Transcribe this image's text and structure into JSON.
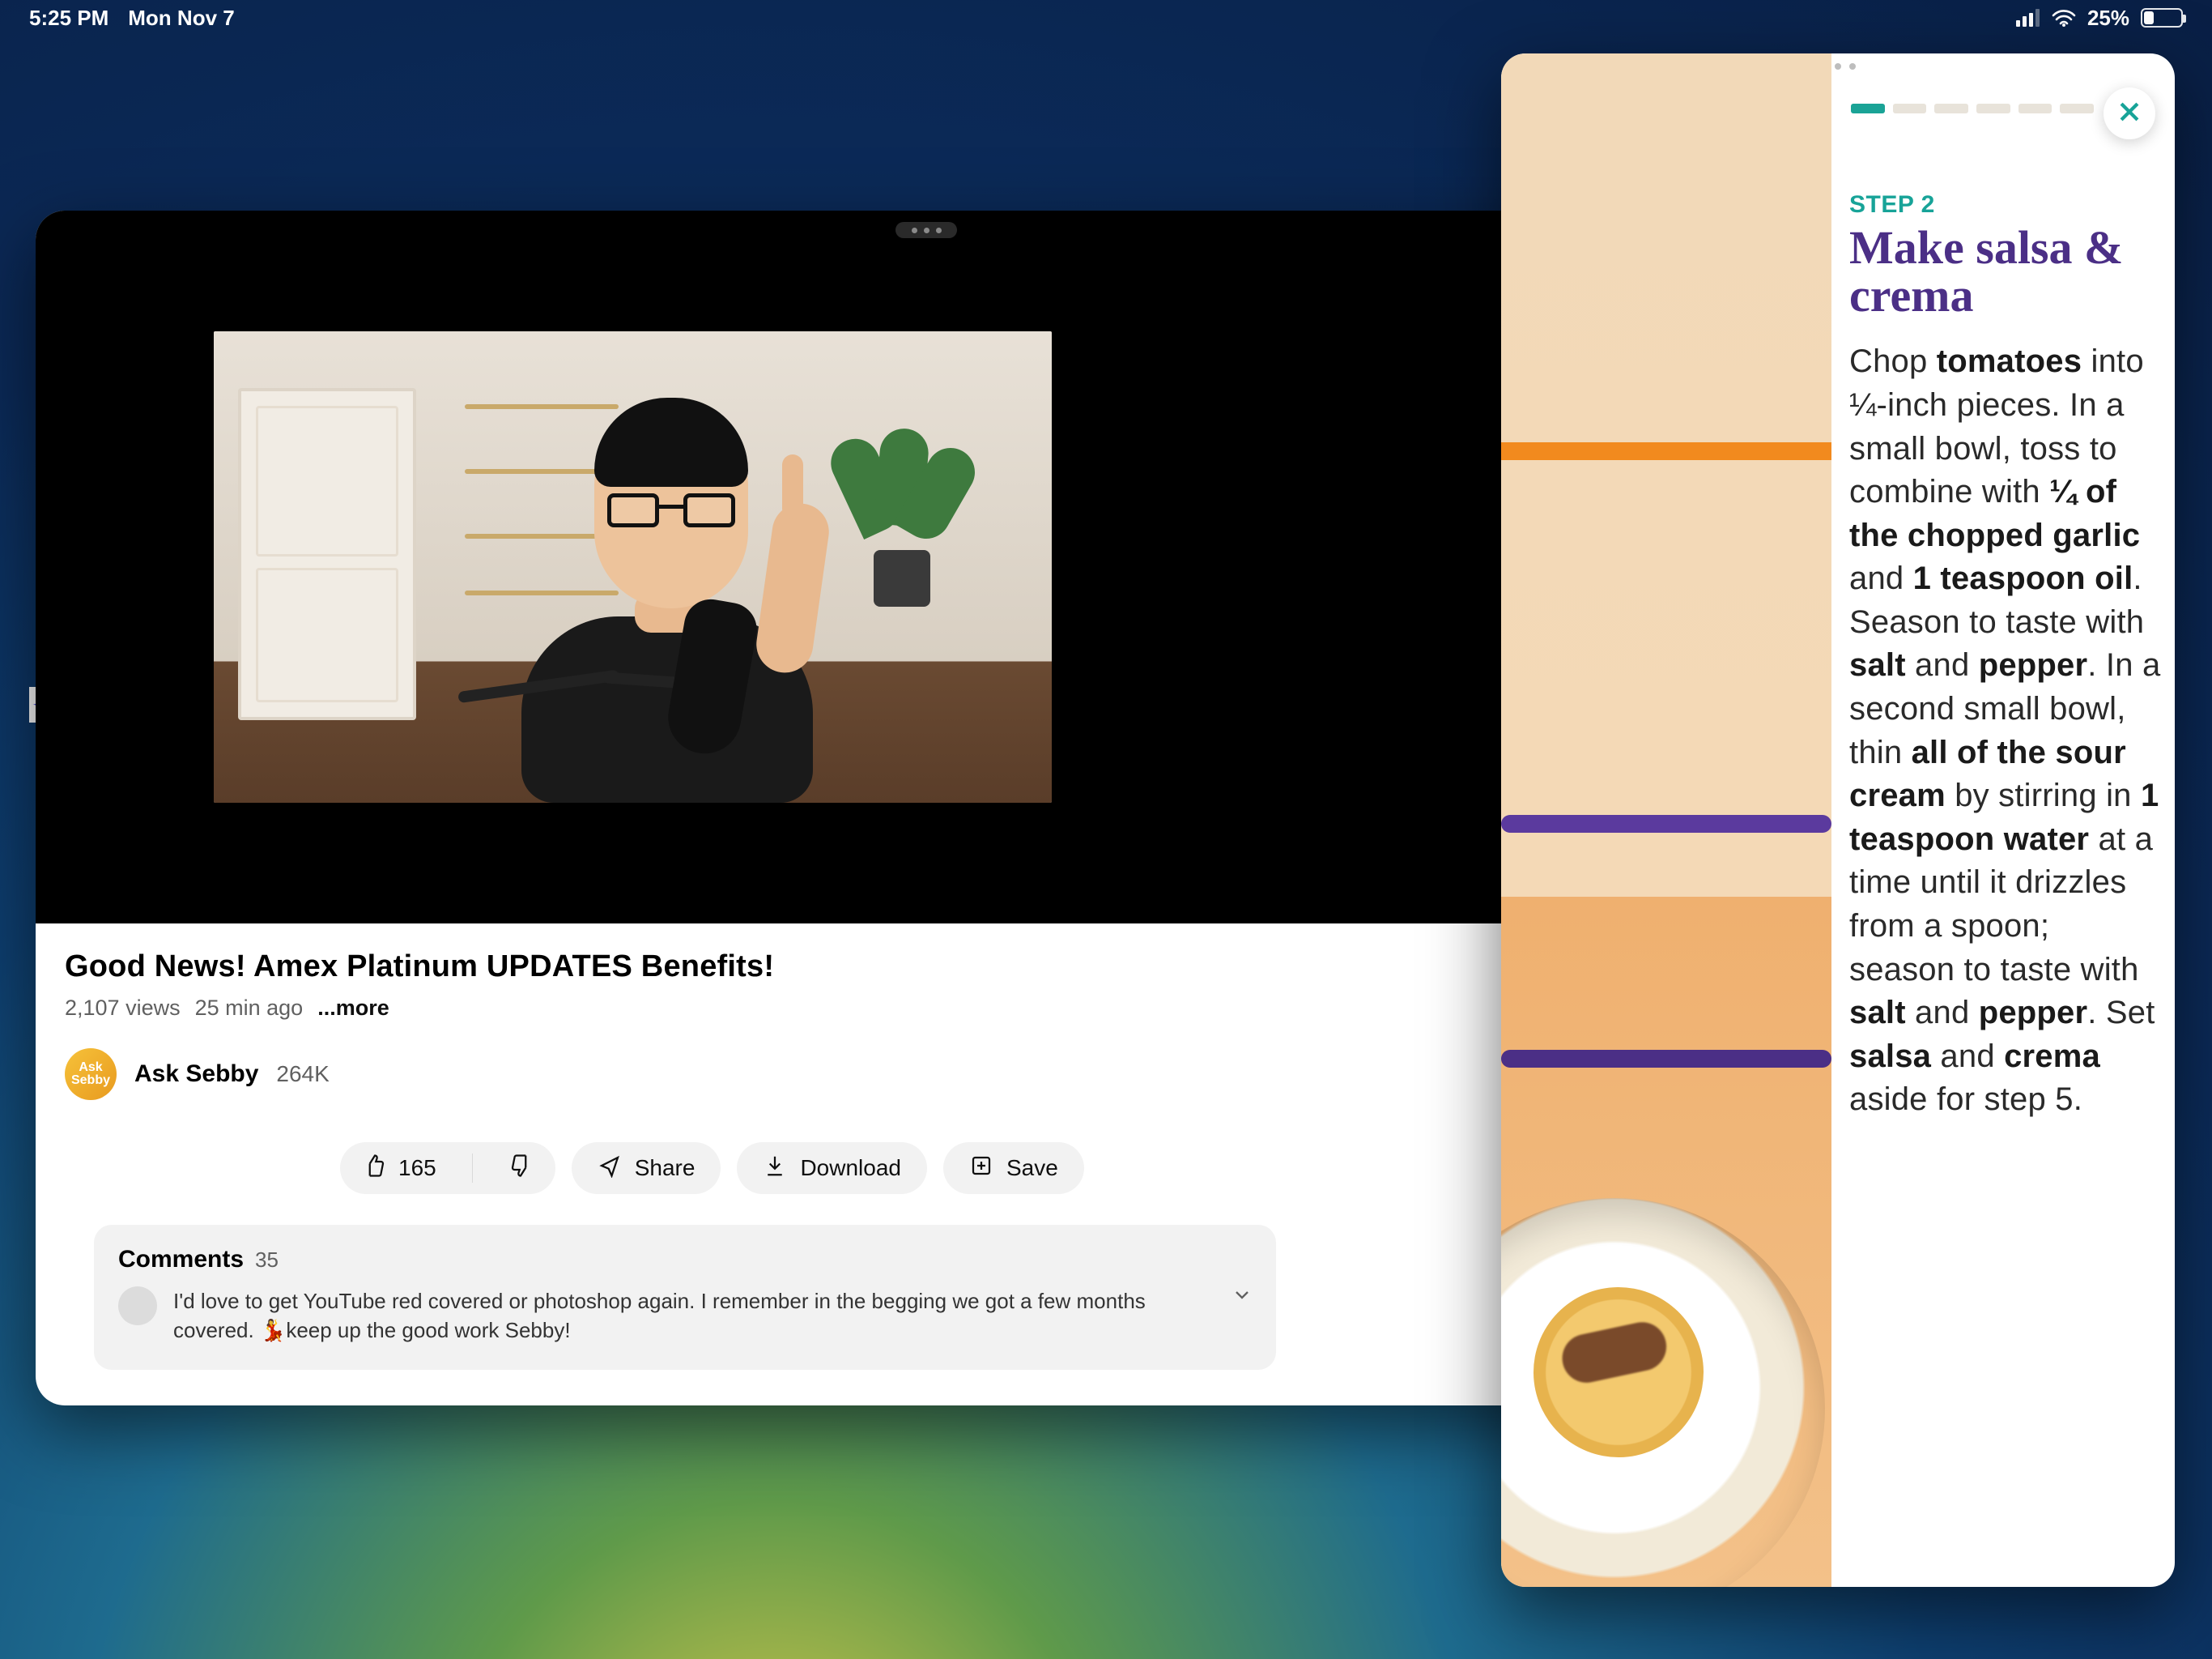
{
  "status": {
    "time": "5:25 PM",
    "date": "Mon Nov 7",
    "battery_pct": "25%"
  },
  "main": {
    "title": "Good News! Amex Platinum UPDATES Benefits!",
    "views": "2,107 views",
    "age": "25 min ago",
    "more": "...more",
    "channel": {
      "name": "Ask Sebby",
      "subs": "264K",
      "avatar_text": "Ask\nSebby"
    },
    "actions": {
      "likes": "165",
      "share": "Share",
      "download": "Download",
      "save": "Save"
    },
    "comments": {
      "label": "Comments",
      "count": "35",
      "top": "I'd love to get YouTube red covered or photoshop again. I remember in the begging we got a few months covered. 💃keep up the good work Sebby!"
    }
  },
  "recipe": {
    "eyebrow": "STEP 2",
    "title": "Make salsa & crema",
    "segments": [
      {
        "t": "Chop "
      },
      {
        "b": "tomatoes"
      },
      {
        "t": " into ¼-inch pieces. In a small bowl, toss to combine with "
      },
      {
        "b": "¼ of the chopped garlic"
      },
      {
        "t": " and "
      },
      {
        "b": "1 teaspoon oil"
      },
      {
        "t": ". Season to taste with "
      },
      {
        "b": "salt"
      },
      {
        "t": " and "
      },
      {
        "b": "pepper"
      },
      {
        "t": ". In a second small bowl, thin "
      },
      {
        "b": "all of the sour cream"
      },
      {
        "t": " by stirring in "
      },
      {
        "b": "1 teaspoon water"
      },
      {
        "t": " at a time until it drizzles from a spoon; season to taste with "
      },
      {
        "b": "salt"
      },
      {
        "t": " and "
      },
      {
        "b": "pepper"
      },
      {
        "t": ". Set "
      },
      {
        "b": "salsa"
      },
      {
        "t": " and "
      },
      {
        "b": "crema"
      },
      {
        "t": " aside for step 5."
      }
    ],
    "progress_total": 6,
    "progress_done": 1
  }
}
